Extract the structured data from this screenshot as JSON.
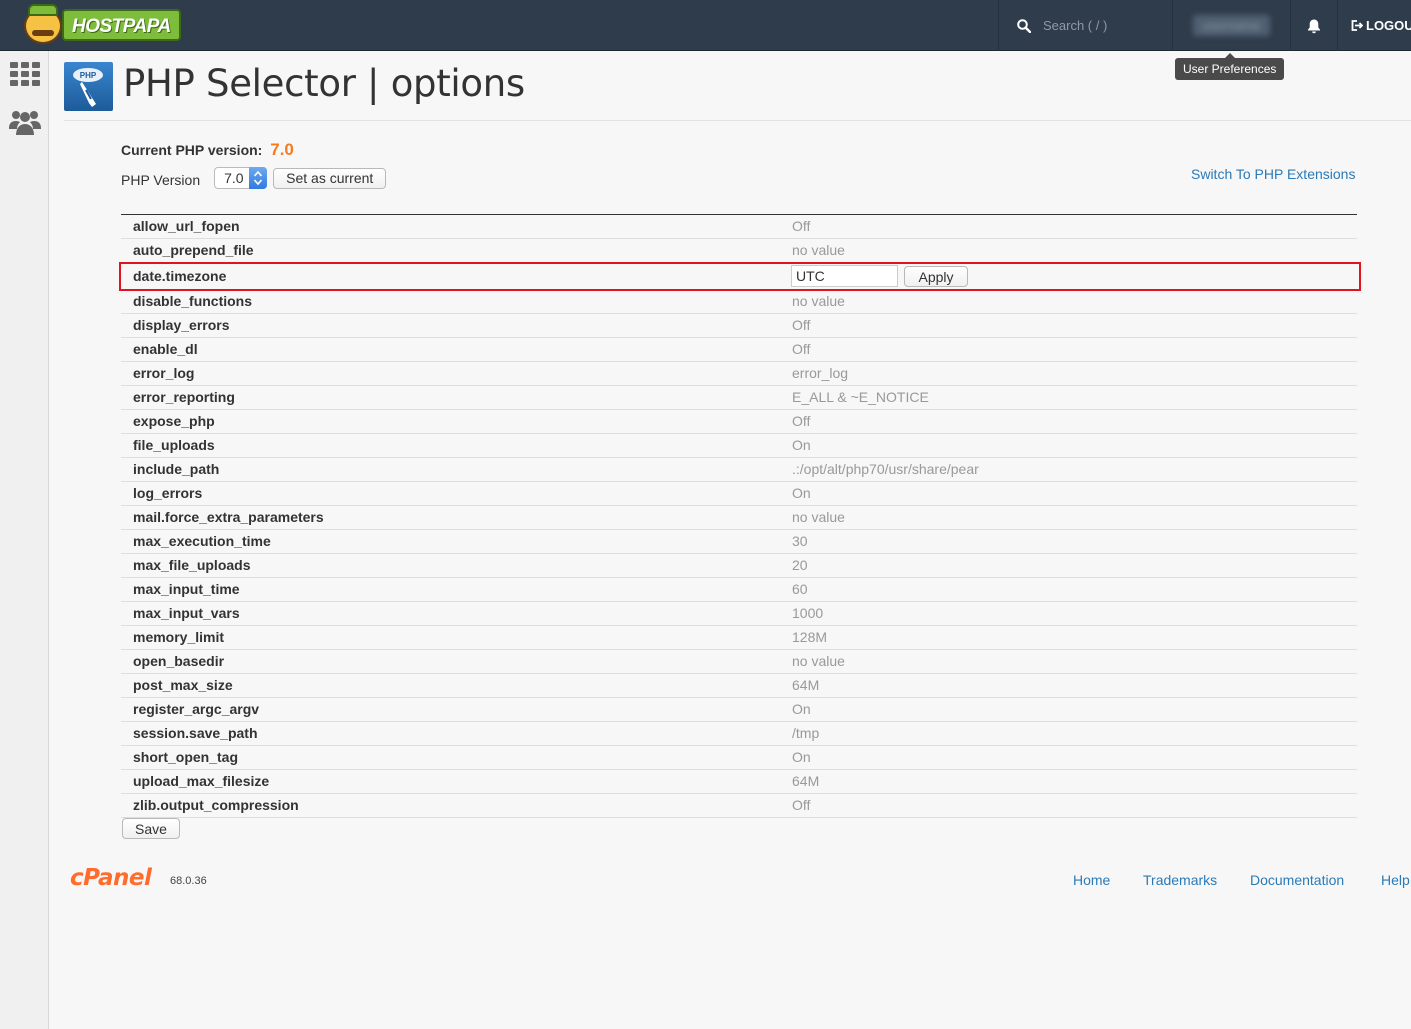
{
  "topbar": {
    "logo_text": "HOSTPAPA",
    "search_placeholder": "Search ( / )",
    "user_name": "username",
    "logout_label": "LOGOUT",
    "tooltip": "User Preferences"
  },
  "header": {
    "title": "PHP Selector | options",
    "icon_text": "PHP"
  },
  "version": {
    "current_label": "Current PHP version:",
    "current_value": "7.0",
    "select_label": "PHP Version",
    "selected": "7.0",
    "set_current_label": "Set as current",
    "switch_link": "Switch To PHP Extensions"
  },
  "options": [
    {
      "name": "allow_url_fopen",
      "value": "Off"
    },
    {
      "name": "auto_prepend_file",
      "value": "no value"
    },
    {
      "name": "date.timezone",
      "value": "UTC",
      "editing": true
    },
    {
      "name": "disable_functions",
      "value": "no value"
    },
    {
      "name": "display_errors",
      "value": "Off"
    },
    {
      "name": "enable_dl",
      "value": "Off"
    },
    {
      "name": "error_log",
      "value": "error_log"
    },
    {
      "name": "error_reporting",
      "value": "E_ALL & ~E_NOTICE"
    },
    {
      "name": "expose_php",
      "value": "Off"
    },
    {
      "name": "file_uploads",
      "value": "On"
    },
    {
      "name": "include_path",
      "value": ".:/opt/alt/php70/usr/share/pear"
    },
    {
      "name": "log_errors",
      "value": "On"
    },
    {
      "name": "mail.force_extra_parameters",
      "value": "no value"
    },
    {
      "name": "max_execution_time",
      "value": "30"
    },
    {
      "name": "max_file_uploads",
      "value": "20"
    },
    {
      "name": "max_input_time",
      "value": "60"
    },
    {
      "name": "max_input_vars",
      "value": "1000"
    },
    {
      "name": "memory_limit",
      "value": "128M"
    },
    {
      "name": "open_basedir",
      "value": "no value"
    },
    {
      "name": "post_max_size",
      "value": "64M"
    },
    {
      "name": "register_argc_argv",
      "value": "On"
    },
    {
      "name": "session.save_path",
      "value": "/tmp"
    },
    {
      "name": "short_open_tag",
      "value": "On"
    },
    {
      "name": "upload_max_filesize",
      "value": "64M"
    },
    {
      "name": "zlib.output_compression",
      "value": "Off"
    }
  ],
  "apply_label": "Apply",
  "save_label": "Save",
  "footer": {
    "brand": "cPanel",
    "version": "68.0.36",
    "links": [
      "Home",
      "Trademarks",
      "Documentation",
      "Help"
    ]
  },
  "colors": {
    "topbar": "#2f3c4b",
    "accent_orange": "#f47c20",
    "link_blue": "#2a7ab8",
    "highlight_red": "#e0141c"
  }
}
